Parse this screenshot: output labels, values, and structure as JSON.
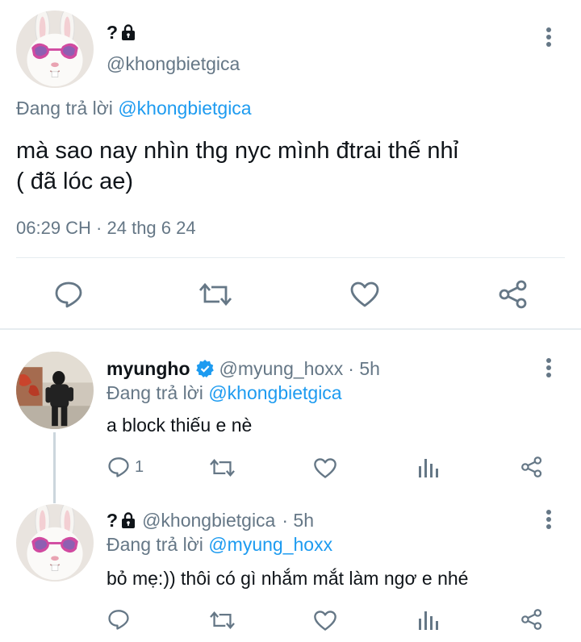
{
  "main_tweet": {
    "display_name": "?",
    "handle": "@khongbietgica",
    "replying_prefix": "Đang trả lời",
    "replying_to": "@khongbietgica",
    "text_line1": "mà sao nay nhìn thg nyc mình đtrai thế nhỉ",
    "text_line2": "( đã lóc ae)",
    "timestamp": "06:29 CH · 24 thg 6 24",
    "icons": [
      "reply-icon",
      "retweet-icon",
      "like-icon",
      "share-icon"
    ]
  },
  "replies": [
    {
      "display_name": "myungho",
      "verified": true,
      "handle": "@myung_hoxx",
      "time": "· 5h",
      "replying_prefix": "Đang trả lời",
      "replying_to": "@khongbietgica",
      "text": "a block thiếu e nè",
      "reply_count": "1"
    },
    {
      "display_name": "?",
      "verified": false,
      "handle": "@khongbietgica",
      "time": "· 5h",
      "replying_prefix": "Đang trả lời",
      "replying_to": "@myung_hoxx",
      "text": "bỏ mẹ:)) thôi có gì nhắm mắt làm ngơ e nhé",
      "reply_count": ""
    }
  ],
  "colors": {
    "link": "#1d9bf0",
    "gray": "#657786",
    "verified": "#1d9bf0",
    "separator": "#e6ecf0"
  }
}
